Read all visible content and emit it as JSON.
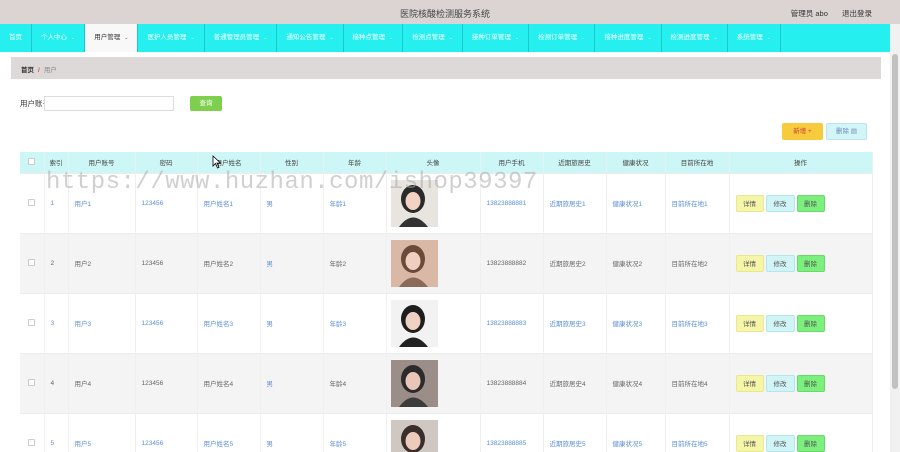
{
  "header": {
    "title": "医院核酸检测服务系统",
    "user_label": "管理员 abo",
    "logout": "退出登录"
  },
  "nav": [
    {
      "label": "首页",
      "caret": false
    },
    {
      "label": "个人中心",
      "caret": true
    },
    {
      "label": "用户管理",
      "caret": true,
      "active": true
    },
    {
      "label": "医护人员管理",
      "caret": true
    },
    {
      "label": "普通管理员管理",
      "caret": true
    },
    {
      "label": "通知公告管理",
      "caret": true
    },
    {
      "label": "接种点管理",
      "caret": true
    },
    {
      "label": "检测点管理",
      "caret": true
    },
    {
      "label": "接种订单管理",
      "caret": true
    },
    {
      "label": "检测订单管理",
      "caret": true
    },
    {
      "label": "接种进度管理",
      "caret": true
    },
    {
      "label": "检测进度管理",
      "caret": true
    },
    {
      "label": "系统管理",
      "caret": true
    }
  ],
  "breadcrumb": {
    "home": "首页",
    "sep": "/",
    "current": "用户"
  },
  "search": {
    "label": "用户账号",
    "placeholder": "",
    "button": "查询"
  },
  "watermark": "https://www.huzhan.com/ishop39397",
  "actions": {
    "add": "新增 +",
    "delete": "删除 ▤"
  },
  "table": {
    "headers": [
      "索引",
      "用户账号",
      "密码",
      "用户姓名",
      "性别",
      "年龄",
      "头像",
      "用户手机",
      "近期旅居史",
      "健康状况",
      "目前所在地",
      "操作"
    ],
    "row_buttons": {
      "detail": "详情",
      "edit": "修改",
      "delete": "删除"
    },
    "rows": [
      {
        "index": "1",
        "account": "用户1",
        "password": "123456",
        "name": "用户姓名1",
        "gender": "男",
        "age": "年龄1",
        "phone": "13823888881",
        "travel": "近期旅居史1",
        "health": "健康状况1",
        "location": "目前所在地1"
      },
      {
        "index": "2",
        "account": "用户2",
        "password": "123456",
        "name": "用户姓名2",
        "gender": "男",
        "age": "年龄2",
        "phone": "13823888882",
        "travel": "近期旅居史2",
        "health": "健康状况2",
        "location": "目前所在地2"
      },
      {
        "index": "3",
        "account": "用户3",
        "password": "123456",
        "name": "用户姓名3",
        "gender": "男",
        "age": "年龄3",
        "phone": "13823888883",
        "travel": "近期旅居史3",
        "health": "健康状况3",
        "location": "目前所在地3"
      },
      {
        "index": "4",
        "account": "用户4",
        "password": "123456",
        "name": "用户姓名4",
        "gender": "男",
        "age": "年龄4",
        "phone": "13823888884",
        "travel": "近期旅居史4",
        "health": "健康状况4",
        "location": "目前所在地4"
      },
      {
        "index": "5",
        "account": "用户5",
        "password": "123456",
        "name": "用户姓名5",
        "gender": "男",
        "age": "年龄5",
        "phone": "13823888885",
        "travel": "近期旅居史5",
        "health": "健康状况5",
        "location": "目前所在地5"
      }
    ]
  },
  "colors": {
    "nav_bg": "#26f0ef",
    "topbar_bg": "#dcd3d3",
    "header_row_bg": "#cdf7f6",
    "link": "#5a8fd8",
    "add_btn": "#f7cc3c",
    "delete_btn": "#7cf07c"
  }
}
